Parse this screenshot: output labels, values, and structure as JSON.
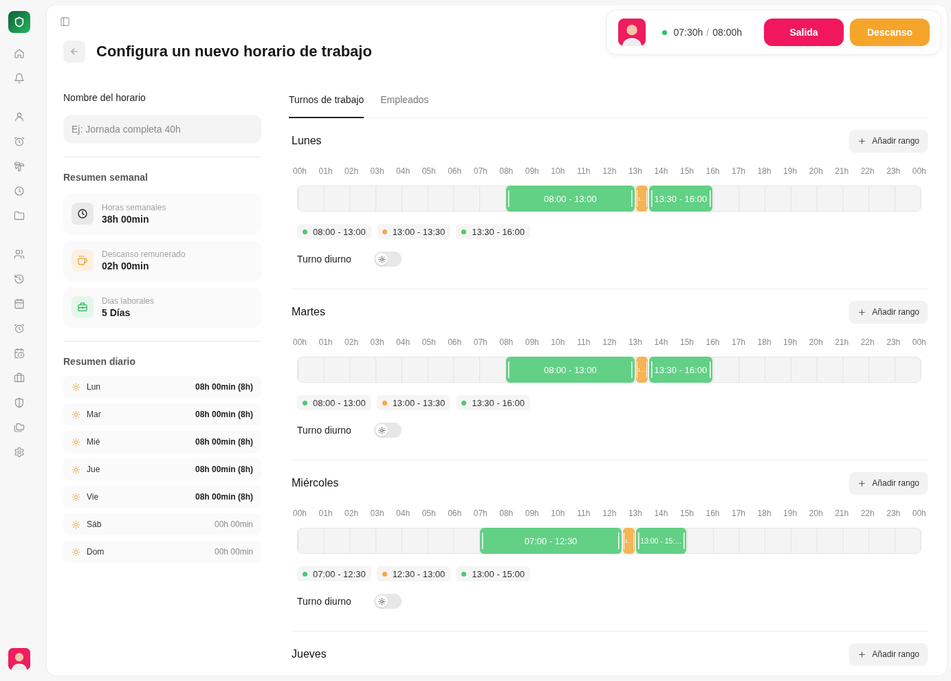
{
  "sidebar": {
    "sections": [
      {
        "items": [
          {
            "selected": false
          },
          {
            "selected": false
          }
        ]
      },
      {
        "items": [
          {
            "selected": false
          },
          {
            "selected": false
          },
          {
            "selected": false
          },
          {
            "selected": false
          },
          {
            "selected": false
          }
        ]
      },
      {
        "items": [
          {
            "selected": false
          },
          {
            "selected": false
          },
          {
            "selected": false
          },
          {
            "selected": false
          },
          {
            "selected": false
          },
          {
            "selected": false
          },
          {
            "selected": false
          },
          {
            "selected": false
          },
          {
            "selected": false
          }
        ]
      }
    ]
  },
  "header": {
    "title": "Configura un nuevo horario de trabajo"
  },
  "clock": {
    "working": true,
    "worked": "07:30h",
    "separator": "/",
    "target": "08:00h",
    "buttons": [
      {
        "kind": "exit",
        "label": "Salida"
      },
      {
        "kind": "break",
        "label": "Descanso"
      }
    ]
  },
  "name_field": {
    "label": "Nombre del horario",
    "placeholder": "Ej: Jornada completa 40h"
  },
  "weekly_summary": {
    "title": "Resumen semanal",
    "cards": [
      {
        "kind": "hours",
        "label": "Horas semanales",
        "value": "38h 00min"
      },
      {
        "kind": "break",
        "label": "Descanso remunerado",
        "value": "02h 00min"
      },
      {
        "kind": "days",
        "label": "Dias laborales",
        "value": "5 Días"
      }
    ]
  },
  "daily_summary": {
    "title": "Resumen diario",
    "rows": [
      {
        "day": "Lun",
        "total": "08h 00min (8h)",
        "active": true
      },
      {
        "day": "Mar",
        "total": "08h 00min (8h)",
        "active": true
      },
      {
        "day": "Mié",
        "total": "08h 00min (8h)",
        "active": true
      },
      {
        "day": "Jue",
        "total": "08h 00min (8h)",
        "active": true
      },
      {
        "day": "Vie",
        "total": "08h 00min (8h)",
        "active": true
      },
      {
        "day": "Sáb",
        "total": "00h 00min",
        "active": false
      },
      {
        "day": "Dom",
        "total": "00h 00min",
        "active": false
      }
    ]
  },
  "tabs": [
    {
      "label": "Turnos de trabajo",
      "selected": true
    },
    {
      "label": "Empleados",
      "selected": false
    }
  ],
  "days": [
    {
      "name": "Lunes",
      "add_button": "Añadir rango",
      "hours": [
        "00h",
        "01h",
        "02h",
        "03h",
        "04h",
        "05h",
        "06h",
        "07h",
        "08h",
        "09h",
        "10h",
        "11h",
        "12h",
        "13h",
        "14h",
        "15h",
        "16h",
        "17h",
        "18h",
        "19h",
        "20h",
        "21h",
        "22h",
        "23h",
        "00h"
      ],
      "ranges": [
        {
          "kind": "work",
          "block_label": "08:00 - 13:00",
          "tag": "08:00 - 13:00"
        },
        {
          "kind": "break",
          "block_label": "1…",
          "tag": "13:00 - 13:30"
        },
        {
          "kind": "work",
          "block_label": "13:30 - 16:00",
          "tag": "13:30 - 16:00"
        }
      ],
      "shift": {
        "label": "Turno diurno",
        "on": false
      }
    },
    {
      "name": "Martes",
      "add_button": "Añadir rango",
      "hours": [
        "00h",
        "01h",
        "02h",
        "03h",
        "04h",
        "05h",
        "06h",
        "07h",
        "08h",
        "09h",
        "10h",
        "11h",
        "12h",
        "13h",
        "14h",
        "15h",
        "16h",
        "17h",
        "18h",
        "19h",
        "20h",
        "21h",
        "22h",
        "23h",
        "00h"
      ],
      "ranges": [
        {
          "kind": "work",
          "block_label": "08:00 - 13:00",
          "tag": "08:00 - 13:00"
        },
        {
          "kind": "break",
          "block_label": "1…",
          "tag": "13:00 - 13:30"
        },
        {
          "kind": "work",
          "block_label": "13:30 - 16:00",
          "tag": "13:30 - 16:00"
        }
      ],
      "shift": {
        "label": "Turno diurno",
        "on": false
      }
    },
    {
      "name": "Miércoles",
      "add_button": "Añadir rango",
      "hours": [
        "00h",
        "01h",
        "02h",
        "03h",
        "04h",
        "05h",
        "06h",
        "07h",
        "08h",
        "09h",
        "10h",
        "11h",
        "12h",
        "13h",
        "14h",
        "15h",
        "16h",
        "17h",
        "18h",
        "19h",
        "20h",
        "21h",
        "22h",
        "23h",
        "00h"
      ],
      "ranges": [
        {
          "kind": "work",
          "block_label": "07:00 - 12:30",
          "tag": "07:00 - 12:30"
        },
        {
          "kind": "break",
          "block_label": "1…",
          "tag": "12:30 - 13:00"
        },
        {
          "kind": "work",
          "block_label": "13:00 - 15:…",
          "tag": "13:00 - 15:00"
        }
      ],
      "shift": {
        "label": "Turno diurno",
        "on": false
      }
    },
    {
      "name": "Jueves",
      "add_button": "Añadir rango"
    }
  ]
}
